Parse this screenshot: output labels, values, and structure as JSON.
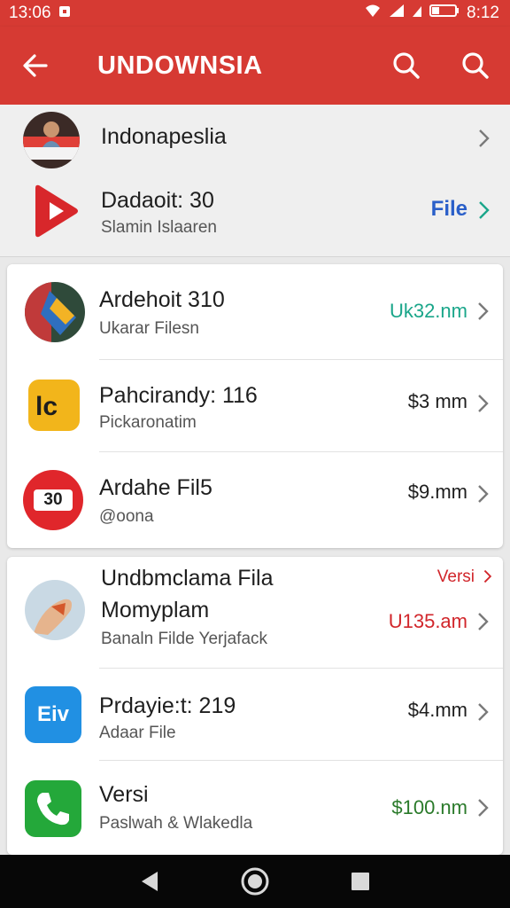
{
  "status_bar": {
    "time": "13:06",
    "clock_right": "8:12"
  },
  "app_bar": {
    "title": "UNDOWNSIA",
    "back_icon": "arrow-left-icon",
    "search_icon": "search-icon"
  },
  "top_items": [
    {
      "title": "Indonapeslia"
    },
    {
      "title": "Dadaoit: 30",
      "subtitle": "Slamin Islaaren",
      "action": "File"
    }
  ],
  "card1": [
    {
      "title": "Ardehoit 310",
      "subtitle": "Ukarar Filesn",
      "value": "Uk32.nm"
    },
    {
      "title": "Pahcirandy: 116",
      "subtitle": "Pickaronatim",
      "value": "$3 mm"
    },
    {
      "title": "Ardahe Fil5",
      "subtitle": "@oona",
      "value": "$9.mm",
      "icon_text": "30"
    }
  ],
  "card2": [
    {
      "title_line1": "Undbmclama Fila",
      "title_line2": "Momyplam",
      "subtitle": "Banaln Filde Yerjafack",
      "tag": "Versi",
      "value": "U135.am"
    },
    {
      "title": "Prdayie:t: 219",
      "subtitle": "Adaar File",
      "value": "$4.mm",
      "icon_text": "Eiv"
    },
    {
      "title": "Versi",
      "subtitle": "Paslwah & Wlakedla",
      "value": "$100.nm"
    }
  ],
  "colors": {
    "brand_red": "#d63a33",
    "teal": "#1aa68a",
    "blue": "#2a5fc9",
    "red_text": "#d1262b",
    "green_text": "#2a7a2a"
  },
  "nav": {
    "back": "nav-back-icon",
    "home": "nav-home-icon",
    "recents": "nav-recents-icon"
  }
}
